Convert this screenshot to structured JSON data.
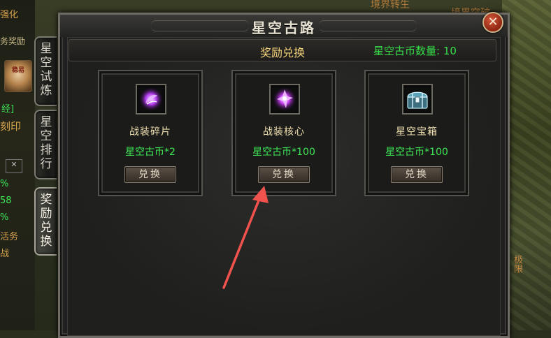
{
  "window": {
    "title": "星空古路",
    "close_label": "✕"
  },
  "header": {
    "title": "奖励兑换",
    "coin_count": "星空古币数量: 10"
  },
  "tabs": [
    {
      "label": [
        "星",
        "空",
        "试",
        "炼"
      ],
      "active": false
    },
    {
      "label": [
        "星",
        "空",
        "排",
        "行"
      ],
      "active": false
    },
    {
      "label": [
        "奖",
        "励",
        "兑",
        "换"
      ],
      "active": true
    }
  ],
  "rewards": [
    {
      "name": "战装碎片",
      "price": "星空古币*2",
      "button": "兑换",
      "icon": "purple-fragment-icon"
    },
    {
      "name": "战装核心",
      "price": "星空古币*100",
      "button": "兑换",
      "icon": "purple-core-icon"
    },
    {
      "name": "星空宝箱",
      "price": "星空古币*100",
      "button": "兑换",
      "icon": "treasure-chest-icon"
    }
  ],
  "background": {
    "left_texts": [
      "强化",
      "务奖励",
      "经]",
      "刻印",
      "%",
      "58",
      "%",
      "活务",
      "战"
    ],
    "scroll_item_label": "稳易",
    "top_texts": [
      "境界转生",
      "境界突破"
    ],
    "right_text": "极限"
  },
  "colors": {
    "accent_green": "#3ee855",
    "title_gold": "#f2d37a",
    "close_red": "#8e2410"
  }
}
